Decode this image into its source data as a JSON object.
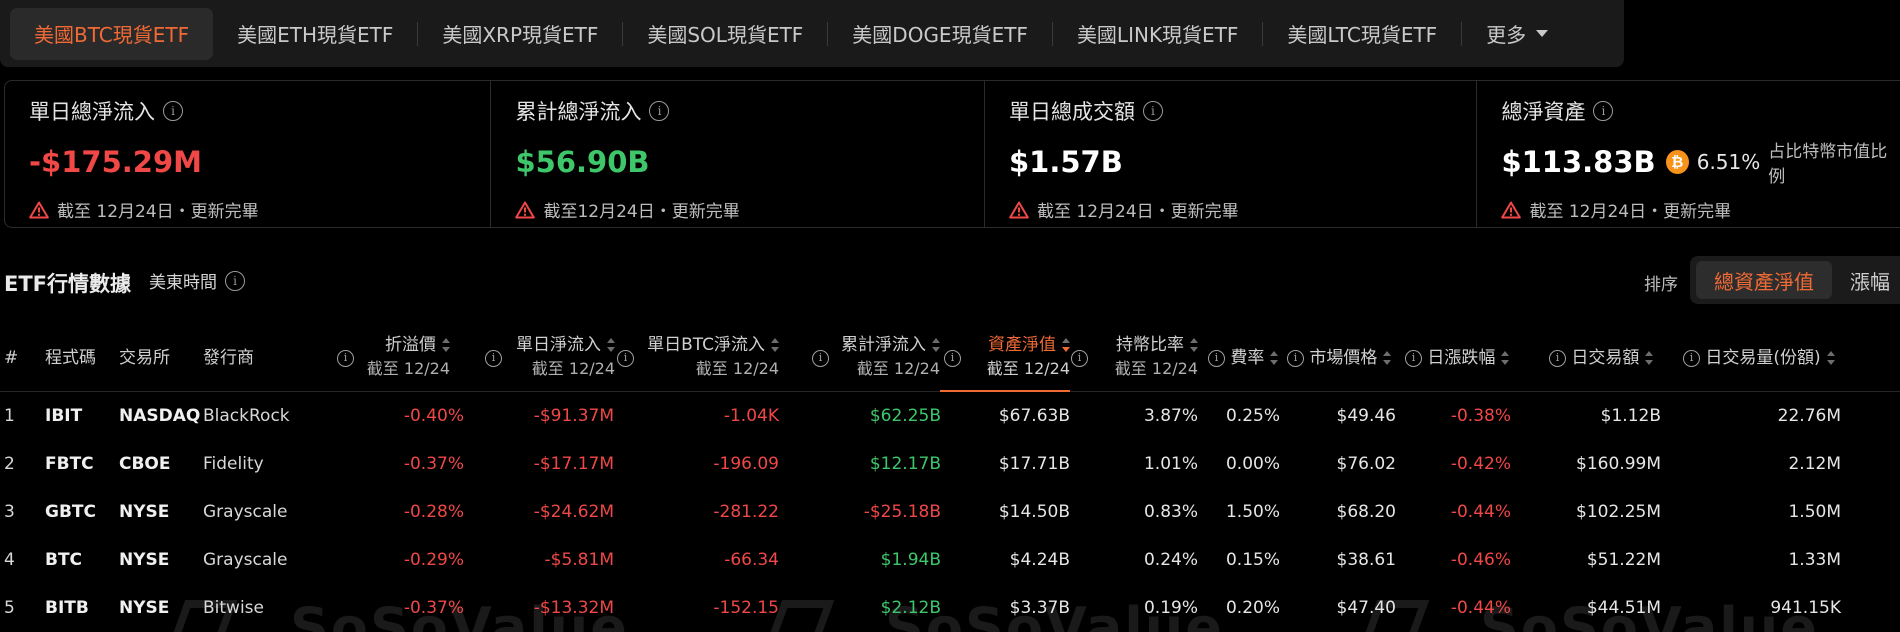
{
  "tabs": [
    {
      "label": "美國BTC現貨ETF",
      "active": true
    },
    {
      "label": "美國ETH現貨ETF"
    },
    {
      "label": "美國XRP現貨ETF"
    },
    {
      "label": "美國SOL現貨ETF"
    },
    {
      "label": "美國DOGE現貨ETF"
    },
    {
      "label": "美國LINK現貨ETF"
    },
    {
      "label": "美國LTC現貨ETF"
    }
  ],
  "more_label": "更多",
  "stats": [
    {
      "title": "單日總淨流入",
      "value": "-$175.29M",
      "note": "截至 12月24日・更新完畢",
      "color": "#f04747"
    },
    {
      "title": "累計總淨流入",
      "value": "$56.90B",
      "note": "截至12月24日・更新完畢",
      "color": "#3ec76a"
    },
    {
      "title": "單日總成交額",
      "value": "$1.57B",
      "note": "截至 12月24日・更新完畢",
      "color": "#ffffff"
    },
    {
      "title": "總淨資產",
      "value": "$113.83B",
      "pct": "6.51%",
      "pct_label": "占比特幣市值比例",
      "note": "截至 12月24日・更新完畢",
      "color": "#ffffff"
    }
  ],
  "section": {
    "title": "ETF行情數據",
    "timezone": "美東時間"
  },
  "sort": {
    "label": "排序",
    "options": [
      "總資產淨值",
      "漲幅"
    ],
    "active": "總資產淨值"
  },
  "headers": {
    "num": "#",
    "ticker": "程式碼",
    "exchange": "交易所",
    "issuer": "發行商",
    "premium": "折溢價",
    "premium_sub": "截至 12/24",
    "daily_inflow": "單日淨流入",
    "daily_inflow_sub": "截至 12/24",
    "daily_btc": "單日BTC淨流入",
    "daily_btc_sub": "截至 12/24",
    "cum_inflow": "累計淨流入",
    "cum_inflow_sub": "截至 12/24",
    "nav": "資產淨值",
    "nav_sub": "截至 12/24",
    "holding": "持幣比率",
    "holding_sub": "截至 12/24",
    "fee": "費率",
    "price": "市場價格",
    "change": "日漲跌幅",
    "volume": "日交易額",
    "shares": "日交易量(份額)"
  },
  "rows": [
    {
      "num": "1",
      "ticker": "IBIT",
      "exchange": "NASDAQ",
      "issuer": "BlackRock",
      "premium": "-0.40%",
      "daily_inflow": "-$91.37M",
      "daily_btc": "-1.04K",
      "cum_inflow": "$62.25B",
      "cum_pos": true,
      "nav": "$67.63B",
      "holding": "3.87%",
      "fee": "0.25%",
      "price": "$49.46",
      "change": "-0.38%",
      "volume": "$1.12B",
      "shares": "22.76M"
    },
    {
      "num": "2",
      "ticker": "FBTC",
      "exchange": "CBOE",
      "issuer": "Fidelity",
      "premium": "-0.37%",
      "daily_inflow": "-$17.17M",
      "daily_btc": "-196.09",
      "cum_inflow": "$12.17B",
      "cum_pos": true,
      "nav": "$17.71B",
      "holding": "1.01%",
      "fee": "0.00%",
      "price": "$76.02",
      "change": "-0.42%",
      "volume": "$160.99M",
      "shares": "2.12M"
    },
    {
      "num": "3",
      "ticker": "GBTC",
      "exchange": "NYSE",
      "issuer": "Grayscale",
      "premium": "-0.28%",
      "daily_inflow": "-$24.62M",
      "daily_btc": "-281.22",
      "cum_inflow": "-$25.18B",
      "cum_pos": false,
      "nav": "$14.50B",
      "holding": "0.83%",
      "fee": "1.50%",
      "price": "$68.20",
      "change": "-0.44%",
      "volume": "$102.25M",
      "shares": "1.50M"
    },
    {
      "num": "4",
      "ticker": "BTC",
      "exchange": "NYSE",
      "issuer": "Grayscale",
      "premium": "-0.29%",
      "daily_inflow": "-$5.81M",
      "daily_btc": "-66.34",
      "cum_inflow": "$1.94B",
      "cum_pos": true,
      "nav": "$4.24B",
      "holding": "0.24%",
      "fee": "0.15%",
      "price": "$38.61",
      "change": "-0.46%",
      "volume": "$51.22M",
      "shares": "1.33M"
    },
    {
      "num": "5",
      "ticker": "BITB",
      "exchange": "NYSE",
      "issuer": "Bitwise",
      "premium": "-0.37%",
      "daily_inflow": "-$13.32M",
      "daily_btc": "-152.15",
      "cum_inflow": "$2.12B",
      "cum_pos": true,
      "nav": "$3.37B",
      "holding": "0.19%",
      "fee": "0.20%",
      "price": "$47.40",
      "change": "-0.44%",
      "volume": "$44.51M",
      "shares": "941.15K"
    }
  ],
  "watermark": "SoSoValue",
  "colors": {
    "accent": "#f06a35",
    "negative": "#f04747",
    "positive": "#3ec76a",
    "btc": "#f7931a"
  },
  "icons": {
    "info": "info-circle-icon",
    "warning": "warning-triangle-icon",
    "btc": "bitcoin-icon",
    "sort": "sort-arrows-icon",
    "dropdown": "chevron-down-icon"
  }
}
